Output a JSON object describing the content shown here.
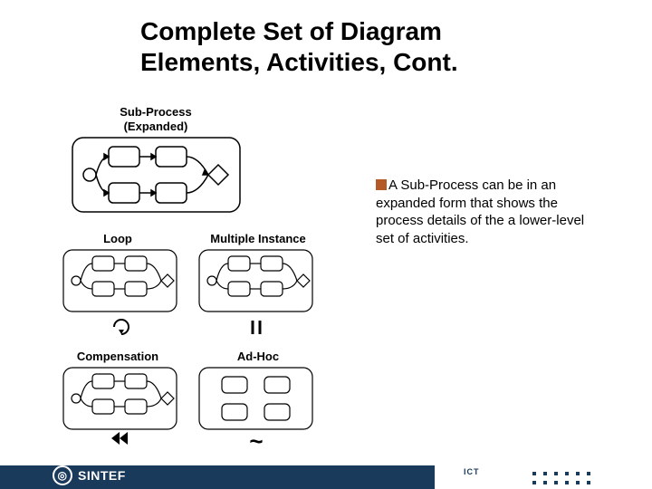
{
  "title": "Complete Set of Diagram Elements, Activities, Cont.",
  "bullet": "A Sub-Process can be in an expanded form that shows the process details of the a lower-level set of activities.",
  "labels": {
    "subprocess_l1": "Sub-Process",
    "subprocess_l2": "(Expanded)",
    "loop": "Loop",
    "multi": "Multiple Instance",
    "comp": "Compensation",
    "adhoc": "Ad-Hoc"
  },
  "footer": {
    "brand": "SINTEF",
    "ict": "ICT"
  }
}
